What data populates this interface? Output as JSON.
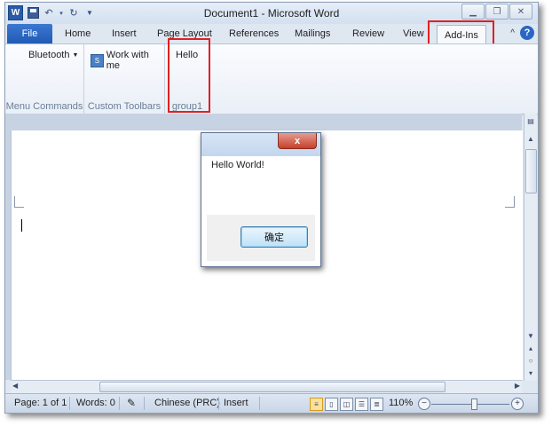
{
  "window": {
    "title": "Document1  -  Microsoft Word"
  },
  "quick_access": {
    "app_icon_label": "W"
  },
  "tabs": [
    {
      "label": "File"
    },
    {
      "label": "Home"
    },
    {
      "label": "Insert"
    },
    {
      "label": "Page Layout"
    },
    {
      "label": "References"
    },
    {
      "label": "Mailings"
    },
    {
      "label": "Review"
    },
    {
      "label": "View"
    },
    {
      "label": "Add-Ins",
      "active": true
    }
  ],
  "ribbon": {
    "groups": [
      {
        "label": "Menu Commands",
        "items": [
          {
            "label": "Bluetooth"
          }
        ]
      },
      {
        "label": "Custom Toolbars",
        "items": [
          {
            "label": "Work with me"
          }
        ]
      },
      {
        "label": "group1",
        "items": [
          {
            "label": "Hello"
          }
        ]
      }
    ]
  },
  "dialog": {
    "close_label": "x",
    "message": "Hello World!",
    "ok_label": "确定"
  },
  "status_bar": {
    "page": "Page: 1 of 1",
    "words": "Words: 0",
    "language": "Chinese (PRC)",
    "mode": "Insert",
    "zoom": "110%",
    "zoom_level": 0.55
  },
  "colors": {
    "highlight": "#e02020",
    "file_tab": "#2a62bc",
    "dialog_close": "#c6402b"
  }
}
